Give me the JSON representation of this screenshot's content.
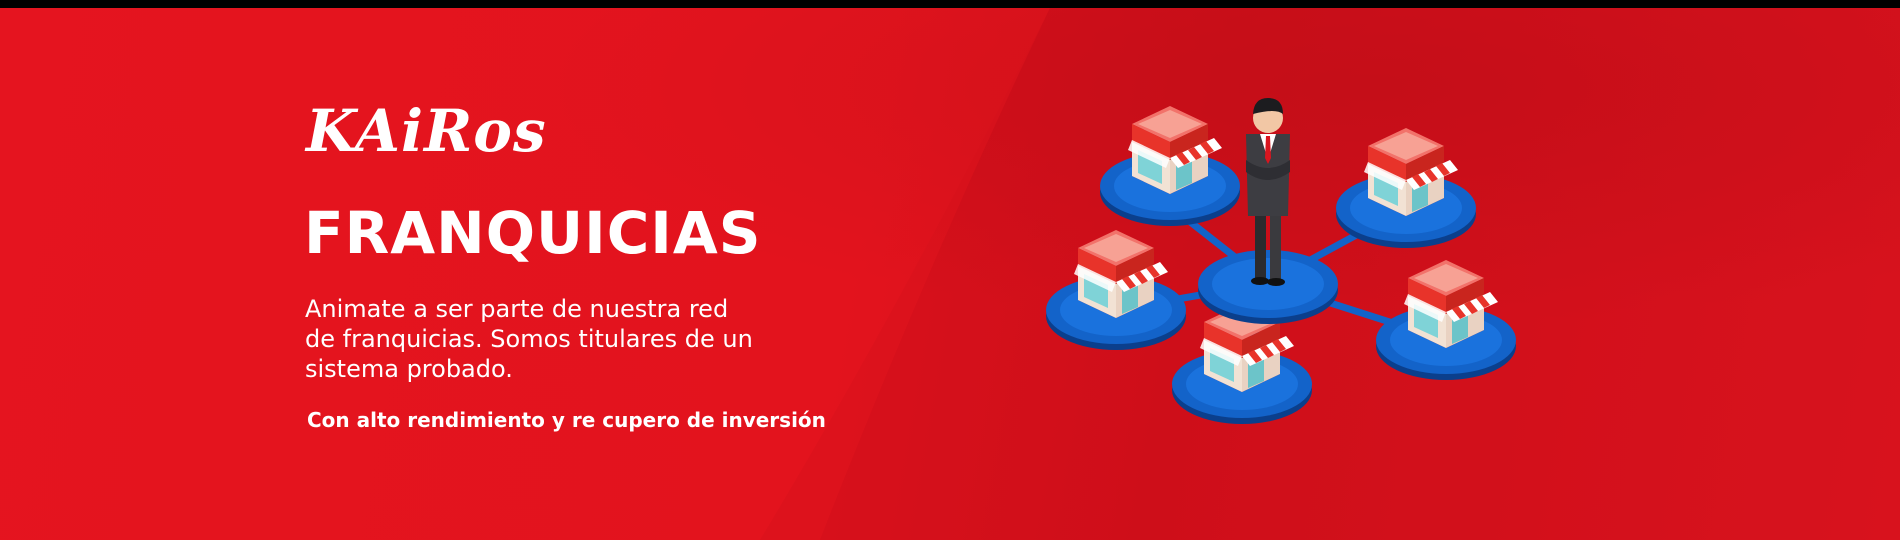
{
  "brand": {
    "logo_text": "KAiRos"
  },
  "hero": {
    "headline": "FRANQUICIAS",
    "description_lines": [
      "Animate a ser parte de nuestra red",
      "de franquicias. Somos titulares de un",
      "sistema probado."
    ],
    "tagline": "Con alto rendimiento y re cupero de inversión"
  },
  "illustration": {
    "icons": [
      "franchise-network-icon",
      "storefront-icon",
      "businessman-icon"
    ],
    "store_count": 5
  },
  "colors": {
    "background_red": "#e3131f",
    "text": "#ffffff",
    "platform_blue": "#1363c9",
    "store_red": "#e8332a"
  }
}
